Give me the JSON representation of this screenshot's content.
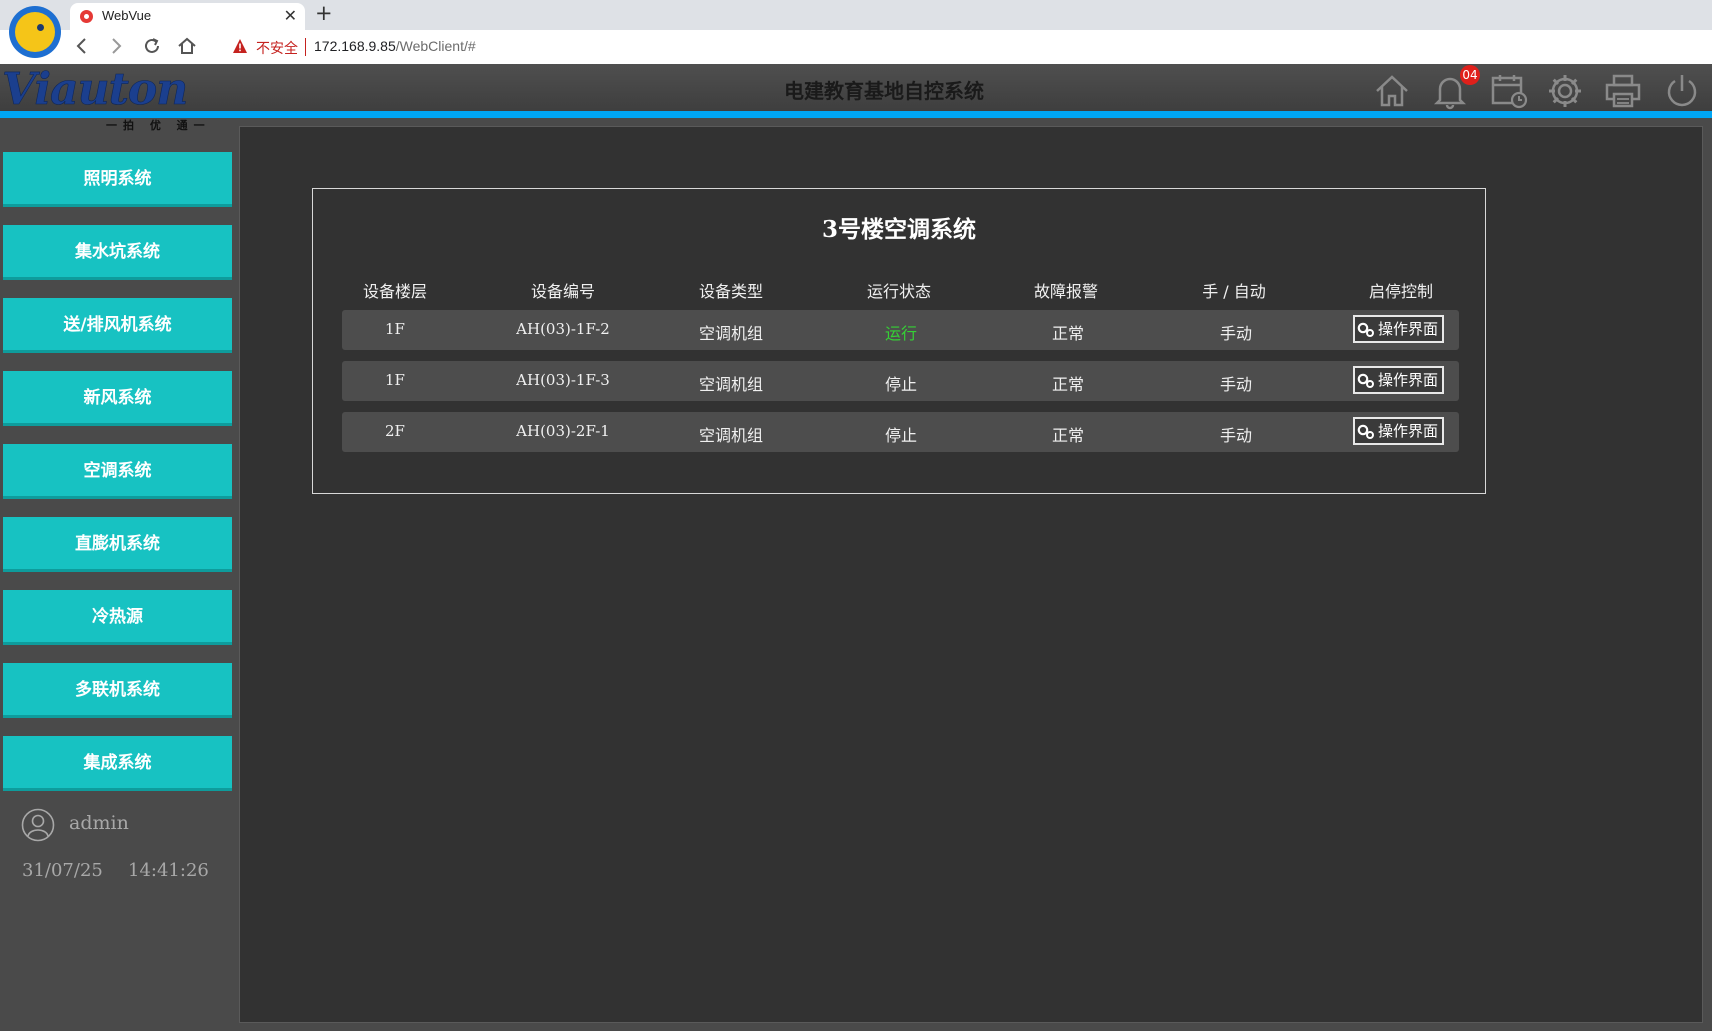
{
  "browser": {
    "tab_title": "WebVue",
    "new_tab": "+",
    "close": "✕",
    "security_label": "不安全",
    "url_host": "172.168.9.85",
    "url_path": "/WebClient/#"
  },
  "header": {
    "logo_text": "Viauton",
    "logo_subtext": "一拍 优 通一",
    "title": "电建教育基地自控系统",
    "notification_count": "04",
    "icons": [
      "home-icon",
      "bell-icon",
      "calendar-clock-icon",
      "gear-icon",
      "printer-icon",
      "power-icon"
    ]
  },
  "sidebar": {
    "items": [
      {
        "label": "照明系统"
      },
      {
        "label": "集水坑系统"
      },
      {
        "label": "送/排风机系统"
      },
      {
        "label": "新风系统"
      },
      {
        "label": "空调系统"
      },
      {
        "label": "直膨机系统"
      },
      {
        "label": "冷热源"
      },
      {
        "label": "多联机系统"
      },
      {
        "label": "集成系统"
      }
    ],
    "user": "admin",
    "date": "31/07/25",
    "time": "14:41:26"
  },
  "panel": {
    "title": "3号楼空调系统",
    "columns": [
      "设备楼层",
      "设备编号",
      "设备类型",
      "运行状态",
      "故障报警",
      "手 / 自动",
      "启停控制"
    ],
    "rows": [
      {
        "floor": "1F",
        "id": "AH(03)-1F-2",
        "type": "空调机组",
        "status": "运行",
        "alarm": "正常",
        "mode": "手动",
        "action": "操作界面"
      },
      {
        "floor": "1F",
        "id": "AH(03)-1F-3",
        "type": "空调机组",
        "status": "停止",
        "alarm": "正常",
        "mode": "手动",
        "action": "操作界面"
      },
      {
        "floor": "2F",
        "id": "AH(03)-2F-1",
        "type": "空调机组",
        "status": "停止",
        "alarm": "正常",
        "mode": "手动",
        "action": "操作界面"
      }
    ]
  },
  "colors": {
    "sidebar_button": "#17c2c2",
    "header_stripe": "#00a6f5",
    "running_status": "#35d135",
    "badge": "#e0201b"
  }
}
